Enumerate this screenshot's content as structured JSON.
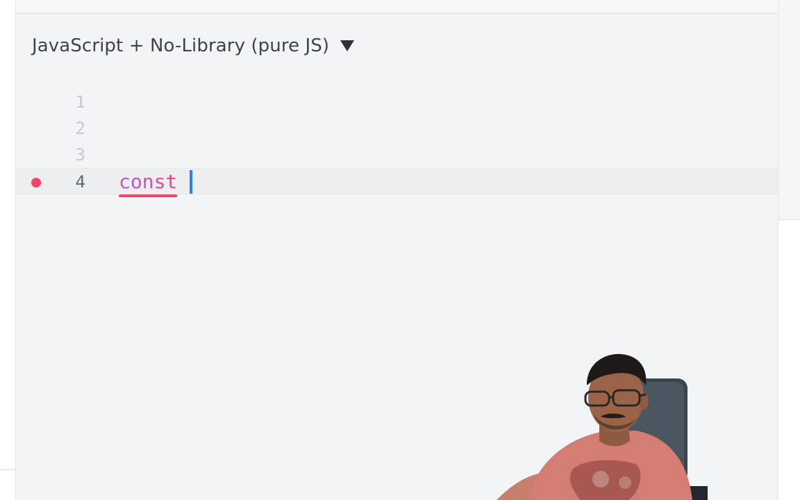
{
  "editor": {
    "language_label": "JavaScript + No-Library (pure JS)",
    "language_caret_icon": "triangle-down-icon",
    "lines": [
      {
        "number": "1",
        "text": ""
      },
      {
        "number": "2",
        "text": ""
      },
      {
        "number": "3",
        "text": ""
      },
      {
        "number": "4",
        "text": "const",
        "active": true,
        "error": true
      }
    ],
    "error_marker_icon": "error-dot-icon"
  },
  "colors": {
    "panel_background": "#f3f4f6",
    "keyword": "#ad52d6",
    "error": "#f0456a",
    "caret": "#2b7fff",
    "line_number": "#c4c7cc",
    "line_number_active": "#62676e"
  },
  "presenter": {
    "description_icon": "webcam-presenter-image"
  }
}
